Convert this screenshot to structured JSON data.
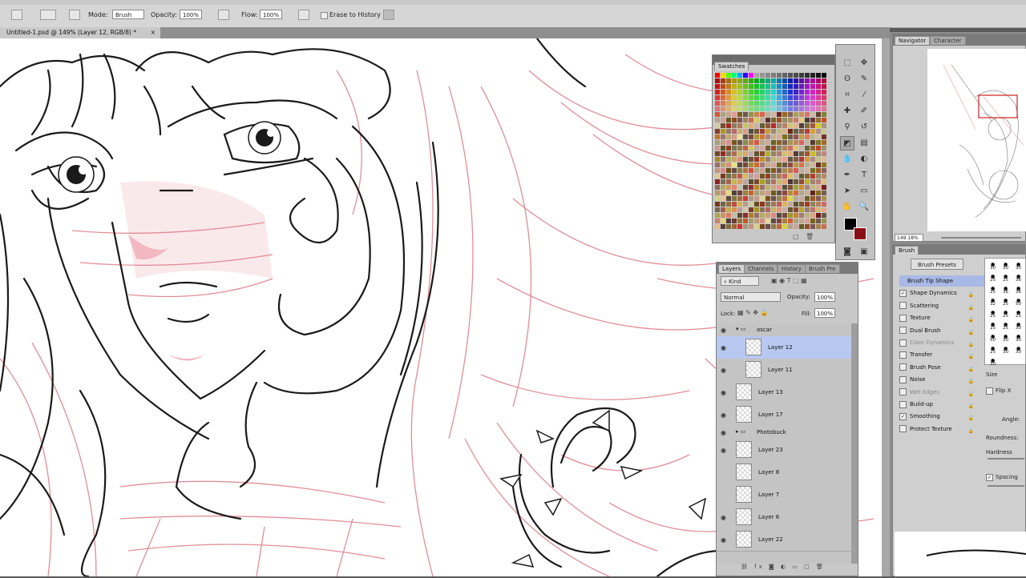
{
  "options_bar": {
    "mode_label": "Mode:",
    "mode_value": "Brush",
    "opacity_label": "Opacity:",
    "opacity_value": "100%",
    "flow_label": "Flow:",
    "flow_value": "100%",
    "erase_history_label": "Erase to History"
  },
  "document": {
    "tab_title": "Untitled-1.psd @ 149% (Layer 12, RGB/8) *"
  },
  "swatches_panel": {
    "title": "Swatches"
  },
  "layers_panel": {
    "tabs": [
      "Layers",
      "Channels",
      "History",
      "Brush Pre"
    ],
    "kind_label": "Kind",
    "blend_mode": "Normal",
    "opacity_label": "Opacity:",
    "opacity_value": "100%",
    "lock_label": "Lock:",
    "fill_label": "Fill:",
    "fill_value": "100%",
    "groups": [
      {
        "name": "oscar"
      },
      {
        "name": "Photobuck"
      }
    ],
    "layers": [
      {
        "name": "Layer 12",
        "selected": true
      },
      {
        "name": "Layer 11",
        "selected": false
      },
      {
        "name": "Layer 13",
        "selected": false
      },
      {
        "name": "Layer 17",
        "selected": false
      },
      {
        "name": "Layer 23",
        "selected": false
      },
      {
        "name": "Layer 8",
        "selected": false
      },
      {
        "name": "Layer 7",
        "selected": false
      },
      {
        "name": "Layer 6",
        "selected": false
      },
      {
        "name": "Layer 22",
        "selected": false
      }
    ]
  },
  "navigator_panel": {
    "tabs": [
      "Navigator",
      "Character"
    ],
    "zoom_value": "149.18%"
  },
  "brush_panel": {
    "title": "Brush",
    "presets_button": "Brush Presets",
    "options": [
      {
        "label": "Brush Tip Shape",
        "checked": false,
        "disabled": false,
        "selected": true
      },
      {
        "label": "Shape Dynamics",
        "checked": true,
        "disabled": false,
        "selected": false
      },
      {
        "label": "Scattering",
        "checked": false,
        "disabled": false,
        "selected": false
      },
      {
        "label": "Texture",
        "checked": false,
        "disabled": false,
        "selected": false
      },
      {
        "label": "Dual Brush",
        "checked": false,
        "disabled": false,
        "selected": false
      },
      {
        "label": "Color Dynamics",
        "checked": false,
        "disabled": true,
        "selected": false
      },
      {
        "label": "Transfer",
        "checked": false,
        "disabled": false,
        "selected": false
      },
      {
        "label": "Brush Pose",
        "checked": false,
        "disabled": false,
        "selected": false
      },
      {
        "label": "Noise",
        "checked": false,
        "disabled": false,
        "selected": false
      },
      {
        "label": "Wet Edges",
        "checked": false,
        "disabled": true,
        "selected": false
      },
      {
        "label": "Build-up",
        "checked": false,
        "disabled": false,
        "selected": false
      },
      {
        "label": "Smoothing",
        "checked": true,
        "disabled": false,
        "selected": false
      },
      {
        "label": "Protect Texture",
        "checked": false,
        "disabled": false,
        "selected": false
      }
    ],
    "size_label": "Size",
    "flip_label": "Flip X",
    "angle_label": "Angle:",
    "roundness_label": "Roundness:",
    "hardness_label": "Hardness",
    "spacing_label": "Spacing",
    "tip_sizes": [
      "30",
      "30",
      "30",
      "25",
      "25",
      "36",
      "25",
      "36",
      "36",
      "32",
      "25",
      "50",
      "25",
      "25",
      "25",
      "25",
      "25",
      "30",
      "50",
      "30",
      "30",
      "25",
      "30",
      "30",
      "30"
    ]
  },
  "colors": {
    "foreground": "#000000",
    "background": "#8a0f18",
    "selection": "#b8c8f0",
    "sketch_red": "#d9707e"
  }
}
